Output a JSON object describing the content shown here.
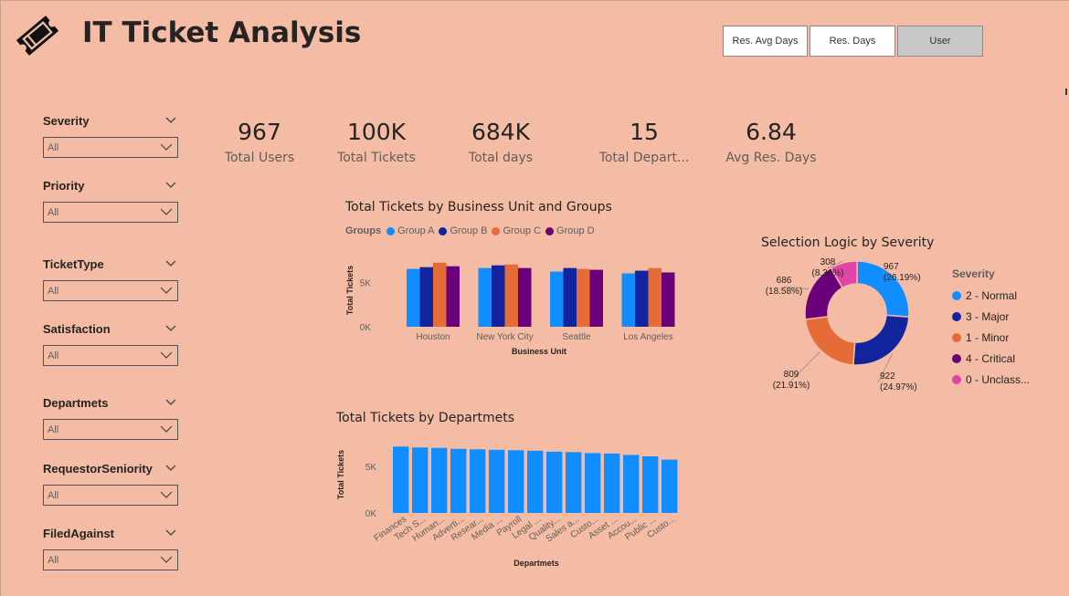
{
  "title": "IT Ticket Analysis",
  "colors": {
    "background": "#f4bca5",
    "groupA": "#118dff",
    "groupB": "#12239e",
    "groupC": "#e66c37",
    "groupD": "#6b007b",
    "unclassified": "#e044a7"
  },
  "icons": {
    "logo": "ticket-icon"
  },
  "tabs": [
    {
      "label": "Res. Avg Days",
      "active": false
    },
    {
      "label": "Res. Days",
      "active": false
    },
    {
      "label": "User",
      "active": true
    }
  ],
  "slicers": [
    {
      "title": "Severity",
      "value": "All"
    },
    {
      "title": "Priority",
      "value": "All"
    },
    {
      "title": "TicketType",
      "value": "All"
    },
    {
      "title": "Satisfaction",
      "value": "All"
    },
    {
      "title": "Departmets",
      "value": "All"
    },
    {
      "title": "RequestorSeniority",
      "value": "All"
    },
    {
      "title": "FiledAgainst",
      "value": "All"
    }
  ],
  "kpis": [
    {
      "value": "967",
      "label": "Total Users"
    },
    {
      "value": "100K",
      "label": "Total Tickets"
    },
    {
      "value": "684K",
      "label": "Total days"
    },
    {
      "value": "15",
      "label": "Total Depart..."
    },
    {
      "value": "6.84",
      "label": "Avg Res. Days"
    }
  ],
  "chart_data": [
    {
      "type": "bar",
      "title": "Total Tickets by Business Unit and Groups",
      "legend_title": "Groups",
      "legend_position": "top-left",
      "xlabel": "Business Unit",
      "ylabel": "Total Tickets",
      "categories": [
        "Houston",
        "New York City",
        "Seattle",
        "Los Angeles"
      ],
      "series": [
        {
          "name": "Group A",
          "values": [
            6500,
            6600,
            6200,
            6000
          ]
        },
        {
          "name": "Group B",
          "values": [
            6700,
            6900,
            6600,
            6300
          ]
        },
        {
          "name": "Group C",
          "values": [
            7200,
            7000,
            6500,
            6600
          ]
        },
        {
          "name": "Group D",
          "values": [
            6800,
            6600,
            6400,
            6100
          ]
        }
      ],
      "yticks": [
        "0K",
        "5K"
      ],
      "ylim": [
        0,
        8000
      ],
      "grid": false
    },
    {
      "type": "pie",
      "title": "Selection Logic by Severity",
      "legend_title": "Severity",
      "legend_position": "right",
      "labels": [
        "2 - Normal",
        "3 - Major",
        "1 - Minor",
        "4 - Critical",
        "0 - Unclass..."
      ],
      "values": [
        967,
        922,
        809,
        686,
        308
      ],
      "percent_labels": [
        "(26.19%)",
        "(24.97%)",
        "(21.91%)",
        "(18.58%)",
        "(8.34%)"
      ]
    },
    {
      "type": "bar",
      "title": "Total Tickets by Departmets",
      "xlabel": "Departmets",
      "ylabel": "Total Tickets",
      "categories": [
        "Finances",
        "Tech S...",
        "Human...",
        "Adverti...",
        "Resear...",
        "Media ...",
        "Payroll",
        "Legal ...",
        "Quality...",
        "Sales a...",
        "Custo...",
        "Asset ...",
        "Accou...",
        "Public ...",
        "Custo..."
      ],
      "values": [
        7100,
        7000,
        6950,
        6850,
        6800,
        6750,
        6700,
        6650,
        6550,
        6500,
        6400,
        6350,
        6200,
        6050,
        5700
      ],
      "yticks": [
        "0K",
        "5K"
      ],
      "ylim": [
        0,
        8000
      ],
      "grid": false
    }
  ]
}
